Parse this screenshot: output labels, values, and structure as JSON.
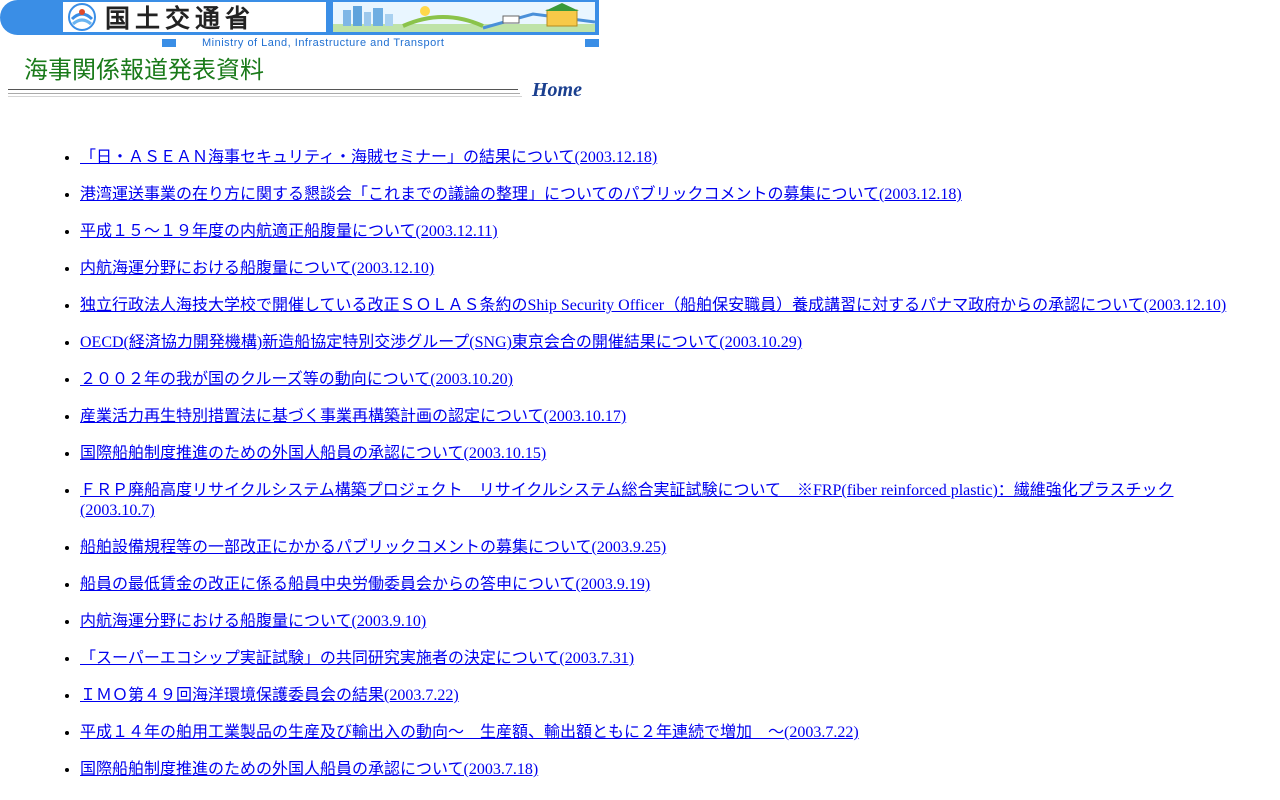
{
  "header": {
    "logo_text": "国土交通省",
    "ministry_en": "Ministry of Land, Infrastructure and Transport",
    "page_title": "海事関係報道発表資料",
    "home_label": "Home"
  },
  "colors": {
    "banner_blue": "#3a8ee6",
    "title_green": "#1a7a1a",
    "link_blue": "#0000ee",
    "home_navy": "#1a3f8f"
  },
  "icons": {
    "emblem": "ministry-emblem-icon",
    "scene": "city-landscape-illustration"
  },
  "press_releases": [
    {
      "text": "「日・ＡＳＥＡＮ海事セキュリティ・海賊セミナー」の結果について(2003.12.18)"
    },
    {
      "text": "港湾運送事業の在り方に関する懇談会「これまでの議論の整理」についてのパブリックコメントの募集について(2003.12.18)"
    },
    {
      "text": "平成１５～１９年度の内航適正船腹量について(2003.12.11)"
    },
    {
      "text": "内航海運分野における船腹量について(2003.12.10)"
    },
    {
      "text": "独立行政法人海技大学校で開催している改正ＳＯＬＡＳ条約のShip Security Officer（船舶保安職員）養成講習に対するパナマ政府からの承認について(2003.12.10)"
    },
    {
      "text": "OECD(経済協力開発機構)新造船協定特別交渉グループ(SNG)東京会合の開催結果について(2003.10.29)"
    },
    {
      "text": "２００２年の我が国のクルーズ等の動向について(2003.10.20)"
    },
    {
      "text": "産業活力再生特別措置法に基づく事業再構築計画の認定について(2003.10.17)"
    },
    {
      "text": "国際船舶制度推進のための外国人船員の承認について(2003.10.15)"
    },
    {
      "text": "ＦＲＰ廃船高度リサイクルシステム構築プロジェクト　リサイクルシステム総合実証試験について　※FRP(fiber reinforced plastic)：繊維強化プラスチック(2003.10.7)"
    },
    {
      "text": "船舶設備規程等の一部改正にかかるパブリックコメントの募集について(2003.9.25)"
    },
    {
      "text": "船員の最低賃金の改正に係る船員中央労働委員会からの答申について(2003.9.19)"
    },
    {
      "text": "内航海運分野における船腹量について(2003.9.10)"
    },
    {
      "text": "「スーパーエコシップ実証試験」の共同研究実施者の決定について(2003.7.31)"
    },
    {
      "text": "ＩＭＯ第４９回海洋環境保護委員会の結果(2003.7.22)"
    },
    {
      "text": "平成１４年の舶用工業製品の生産及び輸出入の動向～　生産額、輸出額ともに２年連続で増加　～(2003.7.22)"
    },
    {
      "text": "国際船舶制度推進のための外国人船員の承認について(2003.7.18)"
    }
  ]
}
